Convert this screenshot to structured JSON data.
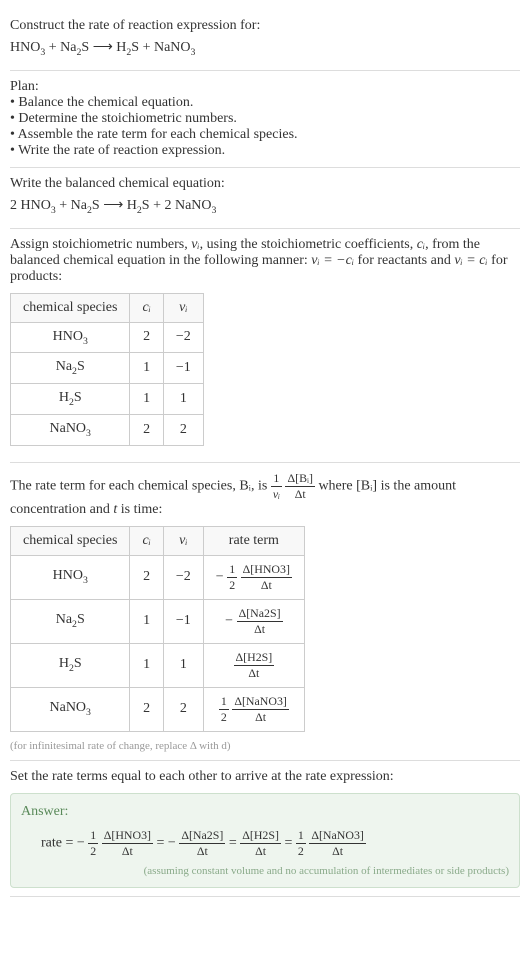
{
  "intro": {
    "line1": "Construct the rate of reaction expression for:",
    "equation": "HNO₃ + Na₂S ⟶ H₂S + NaNO₃"
  },
  "plan": {
    "title": "Plan:",
    "items": [
      "Balance the chemical equation.",
      "Determine the stoichiometric numbers.",
      "Assemble the rate term for each chemical species.",
      "Write the rate of reaction expression."
    ]
  },
  "balanced": {
    "title": "Write the balanced chemical equation:",
    "equation": "2 HNO₃ + Na₂S ⟶ H₂S + 2 NaNO₃"
  },
  "stoich": {
    "intro_before_nu": "Assign stoichiometric numbers, ",
    "nu_i": "νᵢ",
    "intro_mid1": ", using the stoichiometric coefficients, ",
    "c_i": "cᵢ",
    "intro_mid2": ", from the balanced chemical equation in the following manner: ",
    "rel1": "νᵢ = −cᵢ",
    "intro_mid3": " for reactants and ",
    "rel2": "νᵢ = cᵢ",
    "intro_end": " for products:",
    "table": {
      "headers": [
        "chemical species",
        "cᵢ",
        "νᵢ"
      ],
      "rows": [
        {
          "species": "HNO₃",
          "c": "2",
          "nu": "−2"
        },
        {
          "species": "Na₂S",
          "c": "1",
          "nu": "−1"
        },
        {
          "species": "H₂S",
          "c": "1",
          "nu": "1"
        },
        {
          "species": "NaNO₃",
          "c": "2",
          "nu": "2"
        }
      ]
    }
  },
  "rateterm": {
    "text1": "The rate term for each chemical species, ",
    "Bi": "Bᵢ",
    "text2": ", is ",
    "frac1_num": "1",
    "frac1_den": "νᵢ",
    "frac2_num": "Δ[Bᵢ]",
    "frac2_den": "Δt",
    "text3": " where ",
    "conc": "[Bᵢ]",
    "text4": " is the amount concentration and ",
    "t": "t",
    "text5": " is time:",
    "table": {
      "headers": [
        "chemical species",
        "cᵢ",
        "νᵢ",
        "rate term"
      ],
      "rows": [
        {
          "species": "HNO₃",
          "c": "2",
          "nu": "−2",
          "rate_prefix": "−",
          "rate_coef_num": "1",
          "rate_coef_den": "2",
          "rate_num": "Δ[HNO3]",
          "rate_den": "Δt"
        },
        {
          "species": "Na₂S",
          "c": "1",
          "nu": "−1",
          "rate_prefix": "−",
          "rate_coef_num": "",
          "rate_coef_den": "",
          "rate_num": "Δ[Na2S]",
          "rate_den": "Δt"
        },
        {
          "species": "H₂S",
          "c": "1",
          "nu": "1",
          "rate_prefix": "",
          "rate_coef_num": "",
          "rate_coef_den": "",
          "rate_num": "Δ[H2S]",
          "rate_den": "Δt"
        },
        {
          "species": "NaNO₃",
          "c": "2",
          "nu": "2",
          "rate_prefix": "",
          "rate_coef_num": "1",
          "rate_coef_den": "2",
          "rate_num": "Δ[NaNO3]",
          "rate_den": "Δt"
        }
      ]
    },
    "note": "(for infinitesimal rate of change, replace Δ with d)"
  },
  "final": {
    "title": "Set the rate terms equal to each other to arrive at the rate expression:"
  },
  "answer": {
    "label": "Answer:",
    "rate_label": "rate = ",
    "terms": [
      {
        "prefix": "−",
        "coef_num": "1",
        "coef_den": "2",
        "num": "Δ[HNO3]",
        "den": "Δt"
      },
      {
        "prefix": "−",
        "coef_num": "",
        "coef_den": "",
        "num": "Δ[Na2S]",
        "den": "Δt"
      },
      {
        "prefix": "",
        "coef_num": "",
        "coef_den": "",
        "num": "Δ[H2S]",
        "den": "Δt"
      },
      {
        "prefix": "",
        "coef_num": "1",
        "coef_den": "2",
        "num": "Δ[NaNO3]",
        "den": "Δt"
      }
    ],
    "eq": " = ",
    "note": "(assuming constant volume and no accumulation of intermediates or side products)"
  }
}
